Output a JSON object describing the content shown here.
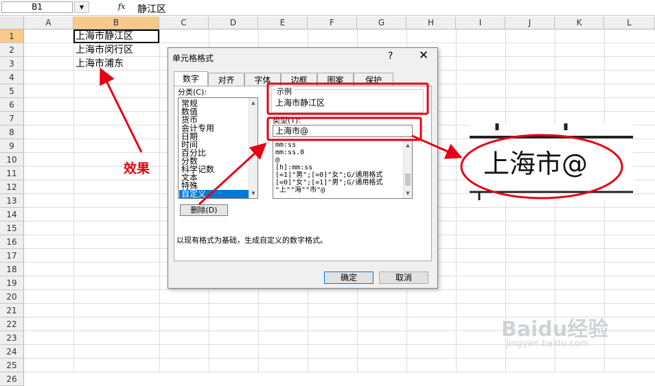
{
  "formula_bar": {
    "name_box": "B1",
    "dropdown_arrow": "▼",
    "fx_label": "fx",
    "formula": "静江区"
  },
  "columns": [
    "A",
    "B",
    "C",
    "D",
    "E",
    "F",
    "G",
    "H",
    "I",
    "J",
    "K",
    "L"
  ],
  "rows": [
    "1",
    "2",
    "3",
    "4",
    "5",
    "6",
    "7",
    "8",
    "9",
    "10",
    "11",
    "12",
    "13",
    "14",
    "15",
    "16",
    "17",
    "18",
    "19",
    "20",
    "21",
    "22",
    "23",
    "24",
    "25",
    "26"
  ],
  "cells": {
    "b1": "上海市静江区",
    "b2": "上海市闵行区",
    "b3": "上海市浦东"
  },
  "dialog": {
    "title": "单元格格式",
    "help": "?",
    "close": "✕",
    "tabs": [
      "数字",
      "对齐",
      "字体",
      "边框",
      "图案",
      "保护"
    ],
    "category_label": "分类(C):",
    "categories": [
      "常规",
      "数值",
      "货币",
      "会计专用",
      "日期",
      "时间",
      "百分比",
      "分数",
      "科学记数",
      "文本",
      "特殊",
      "自定义"
    ],
    "delete_button": "删除(D)",
    "sample_label": "示例",
    "sample_value": "上海市静江区",
    "type_label": "类型(T):",
    "type_value": "上海市@",
    "type_list": [
      "mm:ss",
      "mm:ss.0",
      "@",
      "[h]:mm:ss",
      "[=1]\"男\";[=0]\"女\";G/通用格式",
      "[=0]\"女\";[=1]\"男\";G/通用格式",
      "\"上\"\"海\"\"市\"@"
    ],
    "description": "以现有格式为基础，生成自定义的数字格式。",
    "ok": "确定",
    "cancel": "取消"
  },
  "annotations": {
    "effect_label": "效果",
    "zoom_text": "上海市@",
    "watermark": "Baidu经验",
    "watermark_url": "jingyan.baidu.com",
    "color": "#e60012"
  }
}
